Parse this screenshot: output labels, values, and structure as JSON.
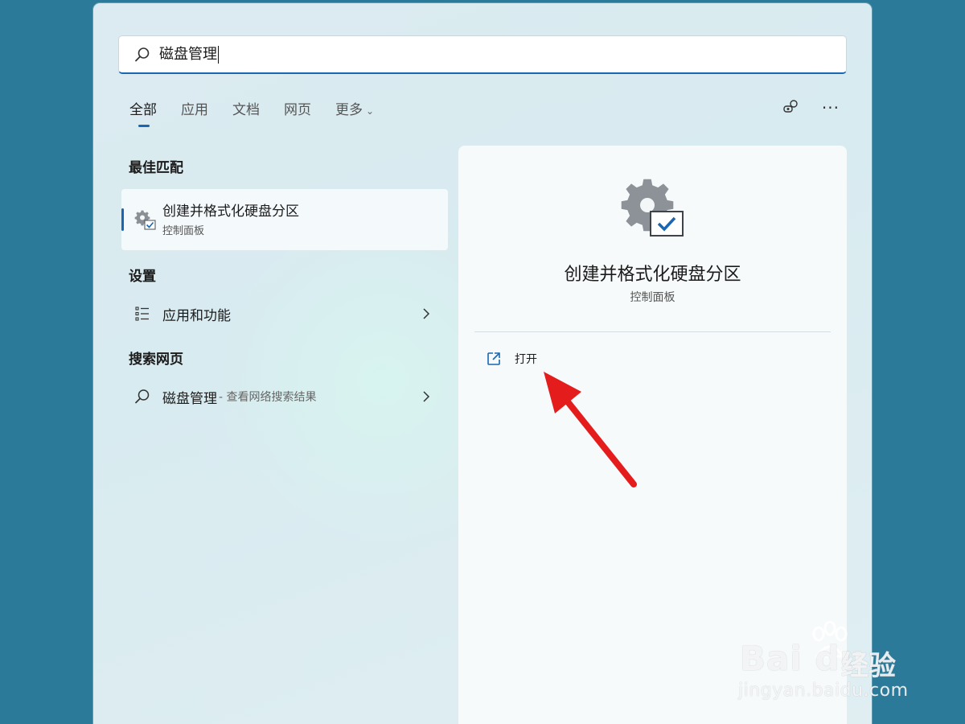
{
  "search": {
    "value": "磁盘管理"
  },
  "tabs": [
    {
      "label": "全部",
      "active": true
    },
    {
      "label": "应用",
      "active": false
    },
    {
      "label": "文档",
      "active": false
    },
    {
      "label": "网页",
      "active": false
    },
    {
      "label": "更多",
      "active": false
    }
  ],
  "top_icons": [
    "accounts-icon",
    "more-options-icon"
  ],
  "left": {
    "best_match": {
      "heading": "最佳匹配",
      "title": "创建并格式化硬盘分区",
      "subtitle": "控制面板",
      "icon": "gear-checkbox-icon"
    },
    "settings": {
      "heading": "设置",
      "item": "应用和功能",
      "icon": "list-icon"
    },
    "web": {
      "heading": "搜索网页",
      "query": "磁盘管理",
      "suffix": " - 查看网络搜索结果",
      "icon": "search-icon"
    }
  },
  "right": {
    "title": "创建并格式化硬盘分区",
    "subtitle": "控制面板",
    "open_label": "打开",
    "open_icon": "open-external-icon"
  },
  "annotation": {
    "arrow_color": "#e51c1c"
  },
  "watermark": {
    "brand": "Bai du",
    "cn": "经验",
    "url": "jingyan.baidu.com"
  },
  "colors": {
    "desktop": "#2b7a99",
    "accent": "#1a66b3"
  }
}
